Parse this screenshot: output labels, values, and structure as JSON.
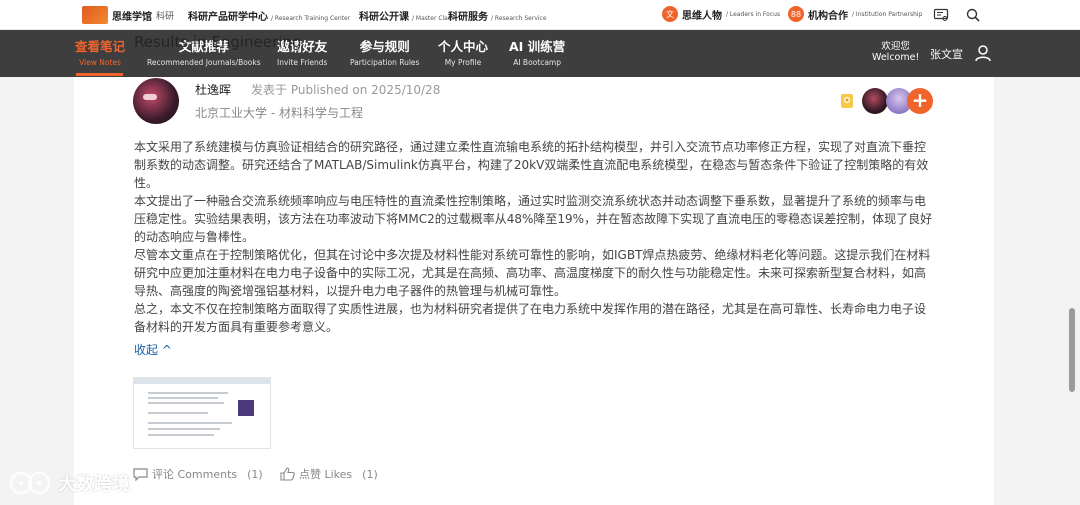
{
  "topbar": {
    "logo_text": "思维学馆",
    "logo_sub": "科研",
    "nav": [
      {
        "zh": "科研产品研学中心",
        "en": "/ Research Training Center"
      },
      {
        "zh": "科研公开课",
        "en": "/ Master Class"
      },
      {
        "zh": "科研服务",
        "en": "/ Research Service"
      }
    ],
    "right": [
      {
        "zh": "思维人物",
        "en": "/ Leaders in Focus",
        "icon": "文"
      },
      {
        "zh": "机构合作",
        "en": "/ Institution Partnership",
        "icon": "88"
      }
    ]
  },
  "navbar": {
    "items": [
      {
        "zh": "查看笔记",
        "en": "View Notes"
      },
      {
        "zh": "文献推荐",
        "en": "Recommended Journals/Books"
      },
      {
        "zh": "邀请好友",
        "en": "Invite Friends"
      },
      {
        "zh": "参与规则",
        "en": "Participation Rules"
      },
      {
        "zh": "个人中心",
        "en": "My Profile"
      },
      {
        "zh": "AI 训练营",
        "en": "AI Bootcamp"
      }
    ],
    "welcome_zh": "欢迎您",
    "welcome_en": "Welcome!",
    "username": "张文宣"
  },
  "overlay_title": "Results in Engineering",
  "post": {
    "author": "杜逸晖",
    "published": "发表于 Published on 2025/10/28",
    "affiliation": "北京工业大学 - 材料科学与工程",
    "add_label": "+",
    "paragraphs": [
      "本文采用了系统建模与仿真验证相结合的研究路径，通过建立柔性直流输电系统的拓扑结构模型，并引入交流节点功率修正方程，实现了对直流下垂控制系数的动态调整。研究还结合了MATLAB/Simulink仿真平台，构建了20kV双端柔性直流配电系统模型，在稳态与暂态条件下验证了控制策略的有效性。",
      "本文提出了一种融合交流系统频率响应与电压特性的直流柔性控制策略，通过实时监测交流系统状态并动态调整下垂系数，显著提升了系统的频率与电压稳定性。实验结果表明，该方法在功率波动下将MMC2的过载概率从48%降至19%，并在暂态故障下实现了直流电压的零稳态误差控制，体现了良好的动态响应与鲁棒性。",
      "尽管本文重点在于控制策略优化，但其在讨论中多次提及材料性能对系统可靠性的影响，如IGBT焊点热疲劳、绝缘材料老化等问题。这提示我们在材料研究中应更加注重材料在电力电子设备中的实际工况，尤其是在高频、高功率、高温度梯度下的耐久性与功能稳定性。未来可探索新型复合材料，如高导热、高强度的陶瓷增强铝基材料，以提升电力电子器件的热管理与机械可靠性。",
      "总之，本文不仅在控制策略方面取得了实质性进展，也为材料研究者提供了在电力系统中发挥作用的潜在路径，尤其是在高可靠性、长寿命电力电子设备材料的开发方面具有重要参考意义。"
    ],
    "collapse_label": "收起 ^",
    "comments_label": "评论 Comments",
    "comments_count": "(1)",
    "likes_label": "点赞 Likes",
    "likes_count": "(1)"
  },
  "watermark": "大数跨境",
  "colors": {
    "accent": "#f0642c",
    "navbar": "#3e3e3e",
    "link": "#1a5fa8"
  }
}
